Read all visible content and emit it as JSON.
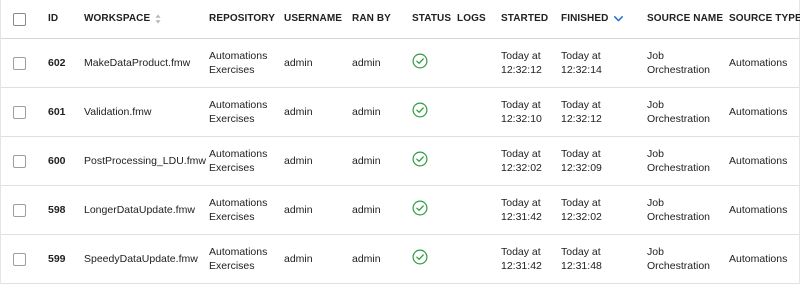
{
  "columns": {
    "id": "ID",
    "workspace": "WORKSPACE",
    "repository": "REPOSITORY",
    "username": "USERNAME",
    "ran_by": "RAN BY",
    "status": "STATUS",
    "logs": "LOGS",
    "started": "STARTED",
    "finished": "FINISHED",
    "source_name": "SOURCE NAME",
    "source_type": "SOURCE TYPE"
  },
  "sort": {
    "column": "finished",
    "direction": "descending",
    "active_color": "#1e6fd9"
  },
  "status_color": "#2e9b3f",
  "rows": [
    {
      "id": "602",
      "workspace": "MakeDataProduct.fmw",
      "repository": [
        "Automations",
        "Exercises"
      ],
      "username": "admin",
      "ran_by": "admin",
      "status_icon": "check-circle-icon",
      "started": [
        "Today at",
        "12:32:12"
      ],
      "finished": [
        "Today at",
        "12:32:14"
      ],
      "source_name": [
        "Job",
        "Orchestration"
      ],
      "source_type": "Automations"
    },
    {
      "id": "601",
      "workspace": "Validation.fmw",
      "repository": [
        "Automations",
        "Exercises"
      ],
      "username": "admin",
      "ran_by": "admin",
      "status_icon": "check-circle-icon",
      "started": [
        "Today at",
        "12:32:10"
      ],
      "finished": [
        "Today at",
        "12:32:12"
      ],
      "source_name": [
        "Job",
        "Orchestration"
      ],
      "source_type": "Automations"
    },
    {
      "id": "600",
      "workspace": "PostProcessing_LDU.fmw",
      "repository": [
        "Automations",
        "Exercises"
      ],
      "username": "admin",
      "ran_by": "admin",
      "status_icon": "check-circle-icon",
      "started": [
        "Today at",
        "12:32:02"
      ],
      "finished": [
        "Today at",
        "12:32:09"
      ],
      "source_name": [
        "Job",
        "Orchestration"
      ],
      "source_type": "Automations"
    },
    {
      "id": "598",
      "workspace": "LongerDataUpdate.fmw",
      "repository": [
        "Automations",
        "Exercises"
      ],
      "username": "admin",
      "ran_by": "admin",
      "status_icon": "check-circle-icon",
      "started": [
        "Today at",
        "12:31:42"
      ],
      "finished": [
        "Today at",
        "12:32:02"
      ],
      "source_name": [
        "Job",
        "Orchestration"
      ],
      "source_type": "Automations"
    },
    {
      "id": "599",
      "workspace": "SpeedyDataUpdate.fmw",
      "repository": [
        "Automations",
        "Exercises"
      ],
      "username": "admin",
      "ran_by": "admin",
      "status_icon": "check-circle-icon",
      "started": [
        "Today at",
        "12:31:42"
      ],
      "finished": [
        "Today at",
        "12:31:48"
      ],
      "source_name": [
        "Job",
        "Orchestration"
      ],
      "source_type": "Automations"
    }
  ]
}
